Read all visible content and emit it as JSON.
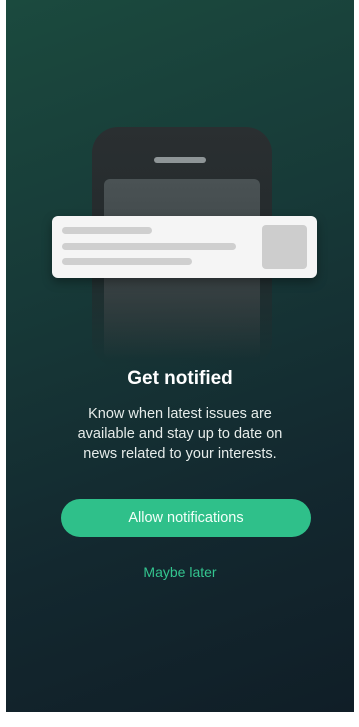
{
  "onboarding": {
    "title": "Get notified",
    "description": "Know when latest issues are available and stay up to date on news related to your interests.",
    "allow_button_label": "Allow notifications",
    "later_link_label": "Maybe later"
  },
  "illustration": {
    "phone_icon": "smartphone-icon",
    "card_icon": "notification-card-icon"
  },
  "colors": {
    "background_top": "#1b4a3e",
    "background_bottom": "#101e27",
    "accent": "#2fc08a",
    "text": "#ffffff"
  }
}
